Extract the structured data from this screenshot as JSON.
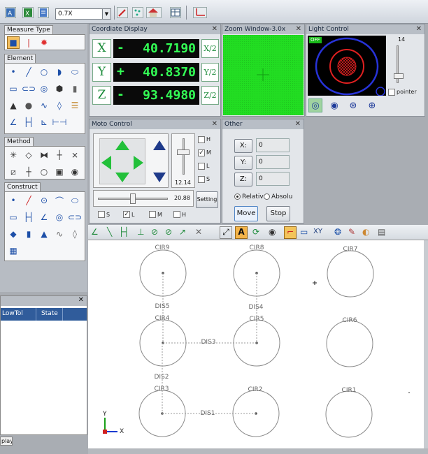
{
  "toolbar": {
    "zoom_value": "0.7X",
    "icons": [
      "measure-app-icon",
      "excel-export-icon",
      "report-icon",
      "probe-icon",
      "point-cloud-icon",
      "house-home-icon",
      "table-icon",
      "coordinate-system-icon"
    ]
  },
  "left_pane": {
    "measure_type": {
      "label": "Measure Type",
      "icons": [
        "camera-icon",
        "probe-icon",
        "laser-icon"
      ]
    },
    "element": {
      "label": "Element",
      "icons": [
        "point-icon",
        "line-icon",
        "circle-icon",
        "arc-icon",
        "ellipse-icon",
        "rectangle-icon",
        "slot-icon",
        "ring-icon",
        "polygon-icon",
        "cylinder-icon",
        "cone-icon",
        "sphere-icon",
        "curve-icon",
        "free-shape-icon",
        "plane-icon",
        "angle-icon",
        "distance-icon",
        "angle-distance-icon",
        "width-icon"
      ]
    },
    "method": {
      "label": "Method",
      "icons": [
        "crosshair-method-icon",
        "diamond-method-icon",
        "edge-method-icon",
        "intersect-method-icon",
        "auto-edge-icon",
        "box-select-icon",
        "cross-select-icon",
        "circle-select-icon",
        "image-method-icon",
        "target-method-icon"
      ]
    },
    "construct": {
      "label": "Construct",
      "icons": [
        "construct-point-icon",
        "construct-line-icon",
        "construct-circle-icon",
        "construct-arc-icon",
        "construct-ellipse-icon",
        "construct-rect-icon",
        "construct-distance-icon",
        "construct-angle-icon",
        "construct-ring-icon",
        "construct-slot-icon",
        "construct-plane-icon",
        "construct-cylinder-icon",
        "construct-cone-icon",
        "construct-curve-icon",
        "construct-shape-icon",
        "calculator-icon"
      ]
    }
  },
  "results": {
    "columns": [
      "LowTol",
      "State"
    ],
    "bottom_tab": "play"
  },
  "coordinate_display": {
    "title": "Coordiate Display",
    "axes": [
      {
        "axis": "X",
        "sign": "-",
        "value": "40.7190",
        "half": "X/2"
      },
      {
        "axis": "Y",
        "sign": "+",
        "value": "40.8370",
        "half": "Y/2"
      },
      {
        "axis": "Z",
        "sign": "-",
        "value": "93.4980",
        "half": "Z/2"
      }
    ]
  },
  "zoom_window": {
    "title": "Zoom Window-3.0x"
  },
  "light_control": {
    "title": "Light Control",
    "status": "OFF",
    "level": "14",
    "level_fraction": 0.14,
    "pointer_label": "pointer",
    "icons": [
      "ring-light-icon",
      "coaxial-light-icon",
      "segment-light-icon",
      "surface-light-icon"
    ]
  },
  "moto_control": {
    "title": "Moto Control",
    "speed_checks": [
      {
        "label": "H",
        "checked": false
      },
      {
        "label": "M",
        "checked": true
      },
      {
        "label": "L",
        "checked": false
      },
      {
        "label": "S",
        "checked": false
      }
    ],
    "z_speed": "12.14",
    "xy_speed": "20.88",
    "setting_label": "Setting",
    "bottom_checks": [
      {
        "label": "S",
        "checked": false
      },
      {
        "label": "L",
        "checked": true
      },
      {
        "label": "M",
        "checked": false
      },
      {
        "label": "H",
        "checked": false
      }
    ]
  },
  "other": {
    "title": "Other",
    "fields": [
      {
        "label": "X:",
        "value": "0"
      },
      {
        "label": "Y:",
        "value": "0"
      },
      {
        "label": "Z:",
        "value": "0"
      }
    ],
    "mode_relative": "Relativ",
    "mode_absolute": "Absolu",
    "move_label": "Move",
    "stop_label": "Stop"
  },
  "graphics_toolbar": {
    "icons": [
      "dim-angle-icon",
      "dim-slope-icon",
      "dim-horizontal-icon",
      "dim-vertical-icon",
      "dim-diameter-icon",
      "dim-radius-icon",
      "dim-curve-icon",
      "dim-cross-icon",
      "zoom-fit-icon",
      "text-label-icon",
      "rotate-view-icon",
      "eye-view-icon",
      "selected-tool-icon",
      "delete-icon",
      "xy-axis-icon",
      "settings-icon",
      "pen-icon",
      "color-icon",
      "printer-icon"
    ],
    "axis_text": "XY"
  },
  "drawing": {
    "circles": [
      "CIR9",
      "CIR8",
      "CIR7",
      "CIR4",
      "CIR5",
      "CIR6",
      "CIR3",
      "CIR2",
      "CIR1"
    ],
    "distances": [
      "DIS5",
      "DIS4",
      "DIS3",
      "DIS2",
      "DIS1"
    ],
    "axis_x": "X",
    "axis_y": "Y"
  },
  "colors": {
    "zoom_green": "#22dd22",
    "readout_green": "#33ff55",
    "selection_blue": "#305c9b",
    "light_ring_red": "#e02020"
  }
}
